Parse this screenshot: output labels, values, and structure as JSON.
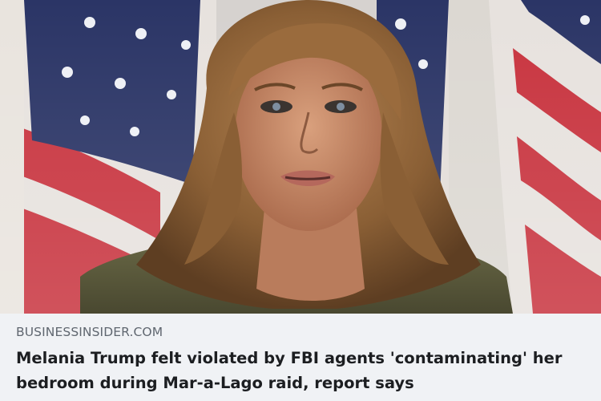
{
  "link_preview": {
    "image": {
      "subject": "woman-portrait",
      "background": "american-flags",
      "colors": {
        "flag_red": "#c8343f",
        "flag_blue": "#2b3566",
        "flag_white": "#e7e2de",
        "hair": "#8a5f35",
        "skin": "#c98d6c",
        "jacket": "#5b5a3c"
      }
    },
    "domain": "BUSINESSINSIDER.COM",
    "headline": "Melania Trump felt violated by FBI agents 'contaminating' her bedroom during Mar-a-Lago raid, report says"
  }
}
